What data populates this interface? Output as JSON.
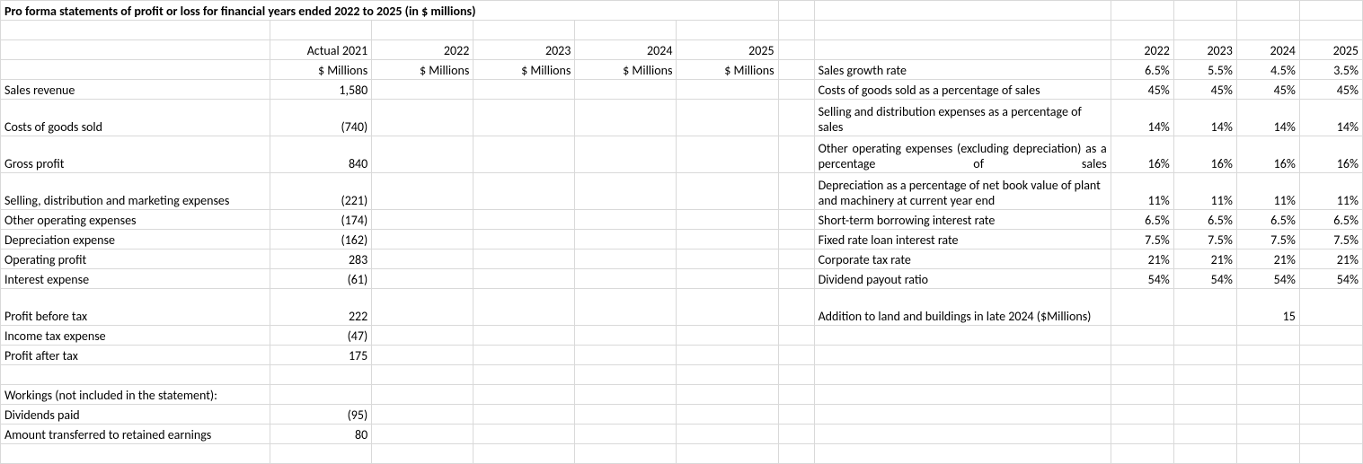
{
  "title": "Pro forma statements of profit or loss for financial years ended 2022 to 2025 (in $ millions)",
  "left": {
    "years_header": [
      "Actual 2021",
      "2022",
      "2023",
      "2024",
      "2025"
    ],
    "unit": "$ Millions",
    "rows": {
      "sales_revenue": {
        "label": "Sales revenue",
        "val": "1,580"
      },
      "cogs": {
        "label": "Costs of goods sold",
        "val": "(740)"
      },
      "gross_profit": {
        "label": "Gross profit",
        "val": "840"
      },
      "sdme": {
        "label": "Selling, distribution and marketing expenses",
        "val": "(221)"
      },
      "other_opex": {
        "label": "Other operating expenses",
        "val": "(174)"
      },
      "dep": {
        "label": "Depreciation expense",
        "val": "(162)"
      },
      "op_profit": {
        "label": "Operating profit",
        "val": "283"
      },
      "interest": {
        "label": "Interest expense",
        "val": "(61)"
      },
      "pbt": {
        "label": "Profit before tax",
        "val": "222"
      },
      "tax": {
        "label": "Income tax expense",
        "val": "(47)"
      },
      "pat": {
        "label": "Profit after tax",
        "val": "175"
      },
      "workings": {
        "label": "Workings (not included in the statement):"
      },
      "divs": {
        "label": "Dividends paid",
        "val": "(95)"
      },
      "retained": {
        "label": "Amount transferred to retained earnings",
        "val": "80"
      }
    }
  },
  "right": {
    "years": [
      "2022",
      "2023",
      "2024",
      "2025"
    ],
    "assumptions": [
      {
        "label": "Sales growth rate",
        "vals": [
          "6.5%",
          "5.5%",
          "4.5%",
          "3.5%"
        ],
        "tall": false
      },
      {
        "label": "Costs of goods sold as a percentage of sales",
        "vals": [
          "45%",
          "45%",
          "45%",
          "45%"
        ],
        "tall": false
      },
      {
        "label": "Selling and distribution expenses as a percentage of sales",
        "vals": [
          "14%",
          "14%",
          "14%",
          "14%"
        ],
        "tall": true
      },
      {
        "label": "Other operating expenses (excluding depreciation) as a percentage of sales",
        "vals": [
          "16%",
          "16%",
          "16%",
          "16%"
        ],
        "tall": true,
        "justify": true
      },
      {
        "label": "Depreciation as a percentage of net book value of plant and machinery at current year end",
        "vals": [
          "11%",
          "11%",
          "11%",
          "11%"
        ],
        "tall": true
      },
      {
        "label": "Short-term borrowing interest rate",
        "vals": [
          "6.5%",
          "6.5%",
          "6.5%",
          "6.5%"
        ],
        "tall": false
      },
      {
        "label": "Fixed rate loan interest rate",
        "vals": [
          "7.5%",
          "7.5%",
          "7.5%",
          "7.5%"
        ],
        "tall": false
      },
      {
        "label": "Corporate tax rate",
        "vals": [
          "21%",
          "21%",
          "21%",
          "21%"
        ],
        "tall": false
      },
      {
        "label": "Dividend payout ratio",
        "vals": [
          "54%",
          "54%",
          "54%",
          "54%"
        ],
        "tall": false
      },
      {
        "label": "Addition to land and buildings in late 2024 ($Millions)",
        "vals": [
          "",
          "",
          "15",
          ""
        ],
        "tall": true
      }
    ]
  }
}
